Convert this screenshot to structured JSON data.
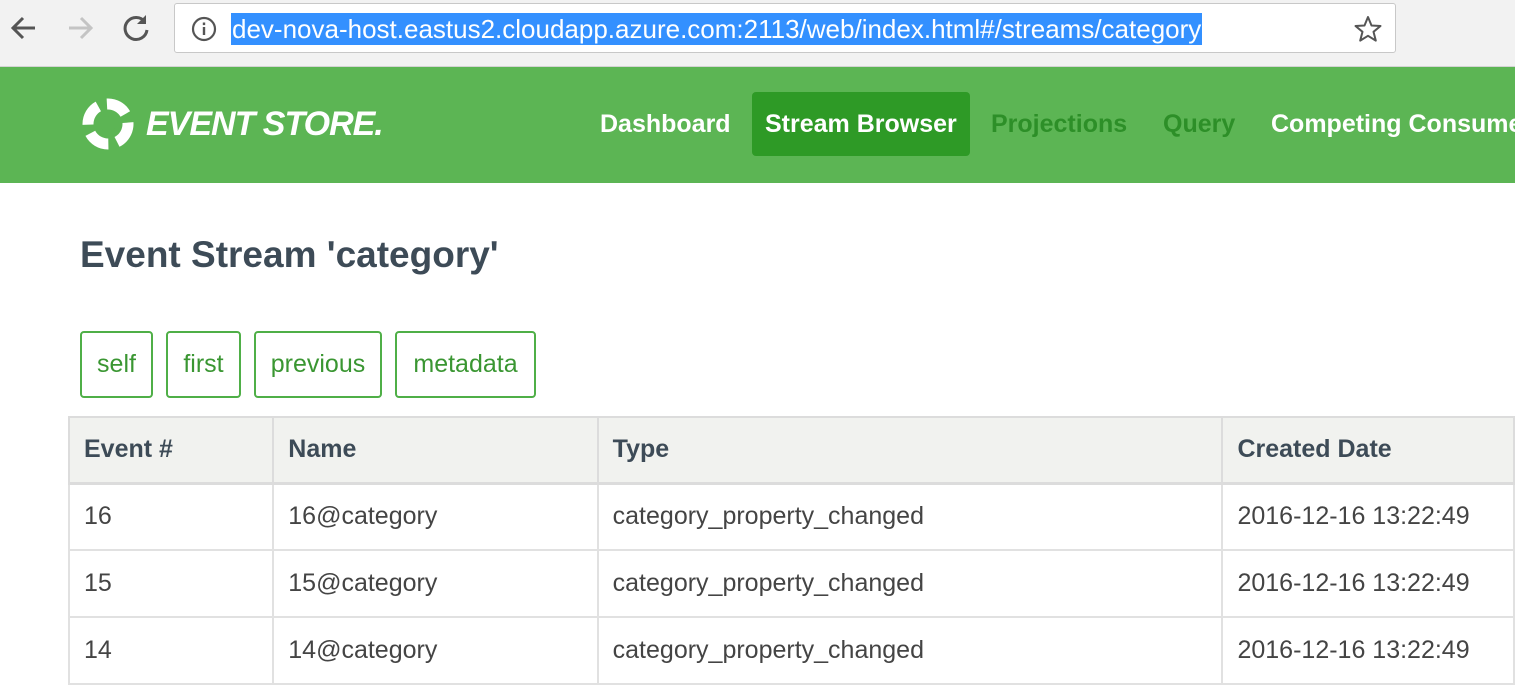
{
  "browser": {
    "url": "dev-nova-host.eastus2.cloudapp.azure.com:2113/web/index.html#/streams/category",
    "icons": {
      "back": "arrow-left-icon",
      "forward": "arrow-right-icon",
      "reload": "reload-icon",
      "info": "info-icon",
      "bookmark": "star-icon"
    }
  },
  "app": {
    "brand": "EVENT STORE.",
    "brand_color": "#5cb554",
    "nav": [
      {
        "label": "Dashboard",
        "state": "normal"
      },
      {
        "label": "Stream Browser",
        "state": "active"
      },
      {
        "label": "Projections",
        "state": "dim"
      },
      {
        "label": "Query",
        "state": "dim"
      },
      {
        "label": "Competing Consume",
        "state": "normal"
      }
    ]
  },
  "page": {
    "title": "Event Stream 'category'",
    "links": [
      "self",
      "first",
      "previous",
      "metadata"
    ]
  },
  "table": {
    "headers": [
      "Event #",
      "Name",
      "Type",
      "Created Date"
    ],
    "rows": [
      {
        "number": "16",
        "name": "16@category",
        "type": "category_property_changed",
        "created": "2016-12-16 13:22:49"
      },
      {
        "number": "15",
        "name": "15@category",
        "type": "category_property_changed",
        "created": "2016-12-16 13:22:49"
      },
      {
        "number": "14",
        "name": "14@category",
        "type": "category_property_changed",
        "created": "2016-12-16 13:22:49"
      }
    ]
  }
}
